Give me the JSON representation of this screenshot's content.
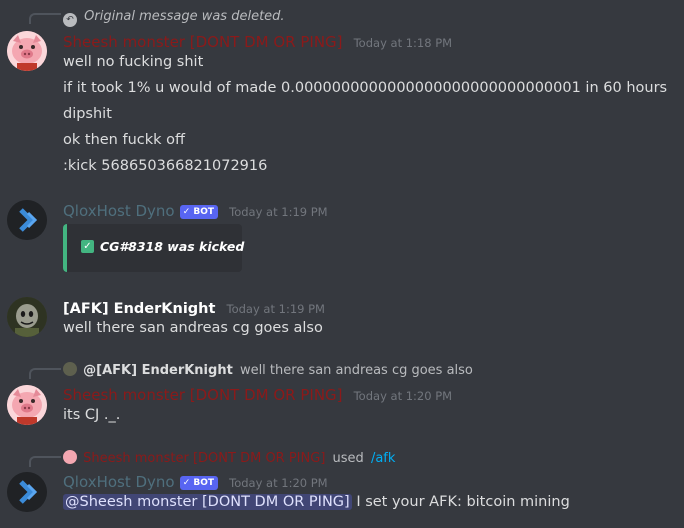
{
  "colors": {
    "background": "#36393f",
    "red_role": "#8b1a1a",
    "bot_name": "#4f6f7d",
    "bot_tag": "#5865f2",
    "timestamp": "#72767d",
    "embed_border": "#43b581",
    "mention_bg": "#414675",
    "mention_text": "#dee0fc",
    "command_link": "#00aff4"
  },
  "messages": [
    {
      "reply_text": "Original message was deleted.",
      "author": "Sheesh monster [DONT DM OR PING]",
      "timestamp": "Today at 1:18 PM",
      "avatar_icon": "pig-avatar-icon",
      "lines": [
        "well no fucking shit",
        "if it took 1% u would of made 0.0000000000000000000000000000001 in 60 hours",
        "dipshit",
        "ok then fuckk off",
        ":kick 568650366821072916"
      ]
    },
    {
      "author": "QloxHost Dyno",
      "bot_tag": "BOT",
      "timestamp": "Today at 1:19 PM",
      "avatar_icon": "dyno-avatar-icon",
      "embed_text": "CG#8318 was kicked",
      "embed_icon": "checkmark-icon"
    },
    {
      "author": "[AFK] EnderKnight",
      "timestamp": "Today at 1:19 PM",
      "avatar_icon": "enderknight-avatar-icon",
      "lines": [
        "well there san andreas cg goes also"
      ]
    },
    {
      "reply_author": "@[AFK] EnderKnight",
      "reply_text": "well there san andreas cg goes also",
      "author": "Sheesh monster [DONT DM OR PING]",
      "timestamp": "Today at 1:20 PM",
      "avatar_icon": "pig-avatar-icon",
      "lines": [
        "its CJ ._."
      ]
    },
    {
      "command_user": "Sheesh monster [DONT DM OR PING]",
      "command_used": "used",
      "command_name": "/afk",
      "author": "QloxHost Dyno",
      "bot_tag": "BOT",
      "timestamp": "Today at 1:20 PM",
      "avatar_icon": "dyno-avatar-icon",
      "mention": "@Sheesh monster [DONT DM OR PING]",
      "text": "I set your AFK: bitcoin mining"
    }
  ]
}
